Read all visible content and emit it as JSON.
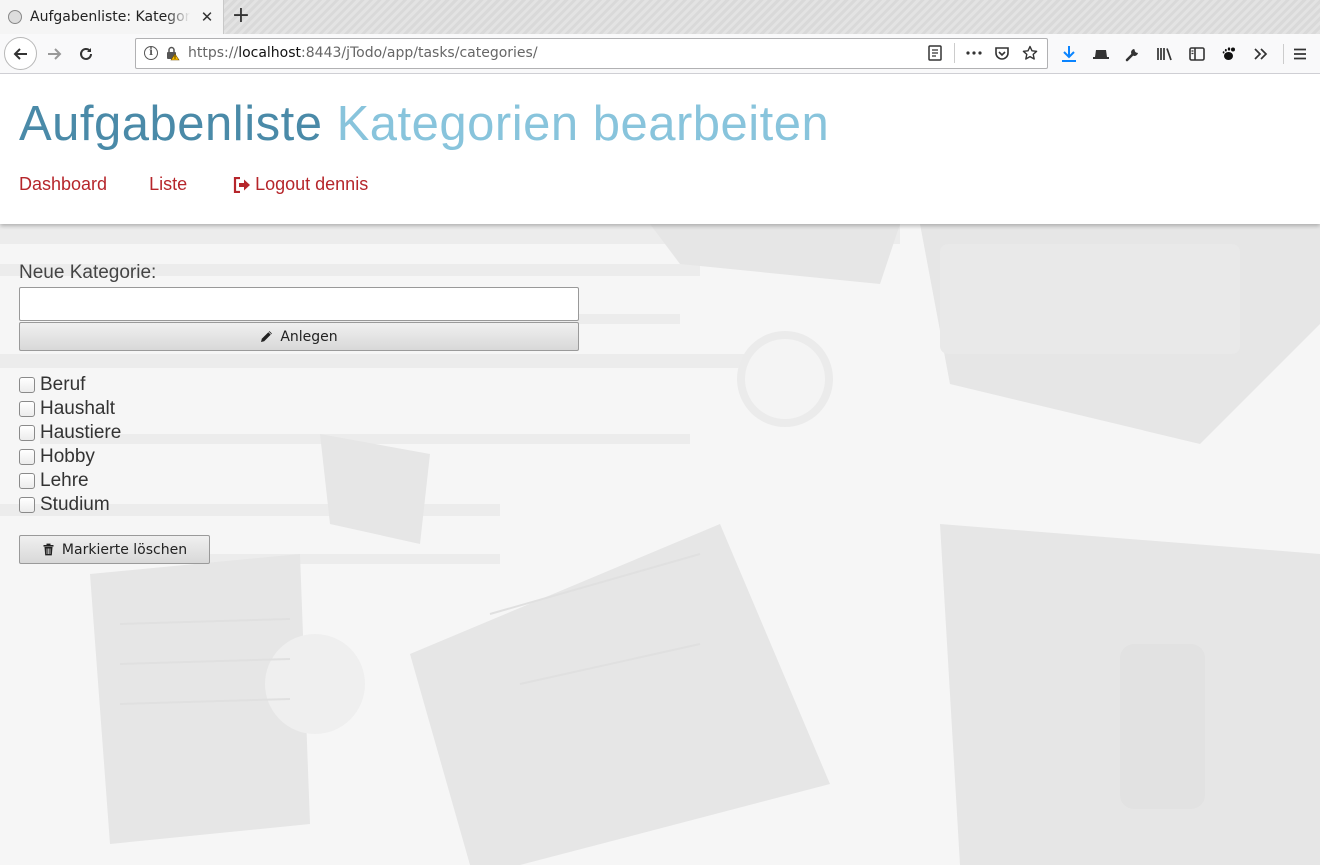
{
  "browser": {
    "tab_title": "Aufgabenliste: Kategorien bearbeiten",
    "tab_close": "✕",
    "new_tab": "+",
    "url_scheme": "https://",
    "url_host": "localhost",
    "url_path": ":8443/jTodo/app/tasks/categories/",
    "icons": [
      "back-icon",
      "forward-icon",
      "reload-icon",
      "site-info-icon",
      "insecure-lock-icon",
      "reader-view-icon",
      "page-actions-icon",
      "pocket-icon",
      "bookmark-star-icon",
      "download-icon",
      "extension-icon",
      "tools-wrench-icon",
      "library-icon",
      "sidebar-icon",
      "gnome-icon",
      "overflow-icon",
      "menu-icon"
    ],
    "accent_color": "#0a84ff"
  },
  "header": {
    "title": "Aufgabenliste",
    "subtitle": "Kategorien bearbeiten",
    "title_color": "#4a8aa8",
    "subtitle_color": "#88c4dc"
  },
  "nav": {
    "dashboard": "Dashboard",
    "liste": "Liste",
    "logout": "Logout dennis",
    "link_color": "#b6262b"
  },
  "form": {
    "new_label": "Neue Kategorie:",
    "new_value": "",
    "create_label": "Anlegen",
    "delete_label": "Markierte löschen"
  },
  "categories": [
    {
      "label": "Beruf",
      "checked": false
    },
    {
      "label": "Haushalt",
      "checked": false
    },
    {
      "label": "Haustiere",
      "checked": false
    },
    {
      "label": "Hobby",
      "checked": false
    },
    {
      "label": "Lehre",
      "checked": false
    },
    {
      "label": "Studium",
      "checked": false
    }
  ]
}
